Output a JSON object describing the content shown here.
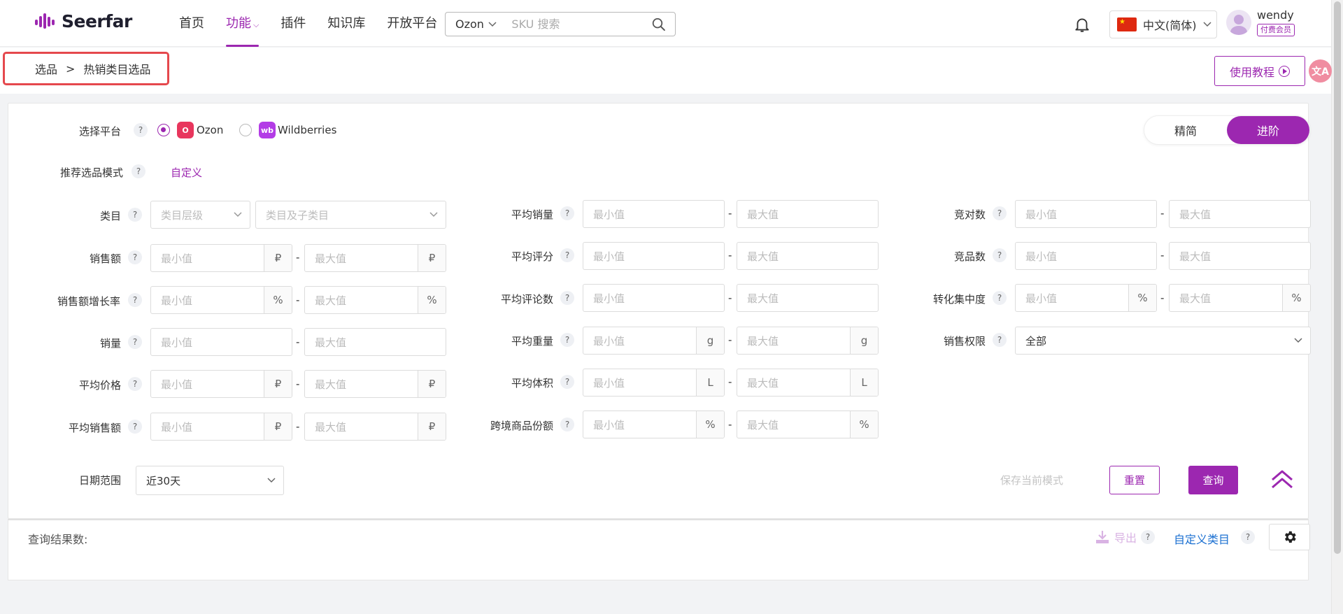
{
  "app": {
    "brand": "Seerfar",
    "brand_color": "#9c27b0"
  },
  "nav": {
    "items": [
      {
        "label": "首页",
        "active": false
      },
      {
        "label": "功能",
        "active": true,
        "has_dropdown": true
      },
      {
        "label": "插件",
        "active": false
      },
      {
        "label": "知识库",
        "active": false
      },
      {
        "label": "开放平台",
        "active": false
      }
    ]
  },
  "search": {
    "platform": "Ozon",
    "placeholder": "SKU 搜索"
  },
  "language": {
    "label": "中文(简体)"
  },
  "user": {
    "name": "wendy",
    "badge": "付费会员"
  },
  "breadcrumb": {
    "root": "选品",
    "separator": ">",
    "current": "热销类目选品"
  },
  "tutorial": {
    "label": "使用教程"
  },
  "platform": {
    "label": "选择平台",
    "options": [
      {
        "name": "Ozon",
        "selected": true
      },
      {
        "name": "Wildberries",
        "selected": false
      }
    ]
  },
  "mode_toggle": {
    "simple": "精简",
    "advanced": "进阶",
    "active": "进阶"
  },
  "recommend": {
    "label": "推荐选品模式",
    "value": "自定义"
  },
  "placeholders": {
    "min": "最小值",
    "max": "最大值"
  },
  "filters": {
    "category": {
      "label": "类目",
      "level_placeholder": "类目层级",
      "sub_placeholder": "类目及子类目"
    },
    "sales_amount": {
      "label": "销售额",
      "unit": "₽"
    },
    "sales_growth": {
      "label": "销售额增长率",
      "unit": "%"
    },
    "sales_volume": {
      "label": "销量"
    },
    "avg_price": {
      "label": "平均价格",
      "unit": "₽"
    },
    "avg_sales_amount": {
      "label": "平均销售额",
      "unit": "₽"
    },
    "avg_volume": {
      "label": "平均销量"
    },
    "avg_rating": {
      "label": "平均评分"
    },
    "avg_reviews": {
      "label": "平均评论数"
    },
    "avg_weight": {
      "label": "平均重量",
      "unit": "g"
    },
    "avg_size": {
      "label": "平均体积",
      "unit": "L"
    },
    "crossborder_share": {
      "label": "跨境商品份额",
      "unit": "%"
    },
    "competitors": {
      "label": "竞对数"
    },
    "competing_products": {
      "label": "竞品数"
    },
    "conversion_concentration": {
      "label": "转化集中度",
      "unit": "%"
    },
    "sales_permission": {
      "label": "销售权限",
      "value": "全部"
    }
  },
  "date_range": {
    "label": "日期范围",
    "value": "近30天"
  },
  "actions": {
    "save": "保存当前模式",
    "reset": "重置",
    "query": "查询"
  },
  "results": {
    "label": "查询结果数:",
    "export": "导出",
    "custom_category": "自定义类目"
  }
}
